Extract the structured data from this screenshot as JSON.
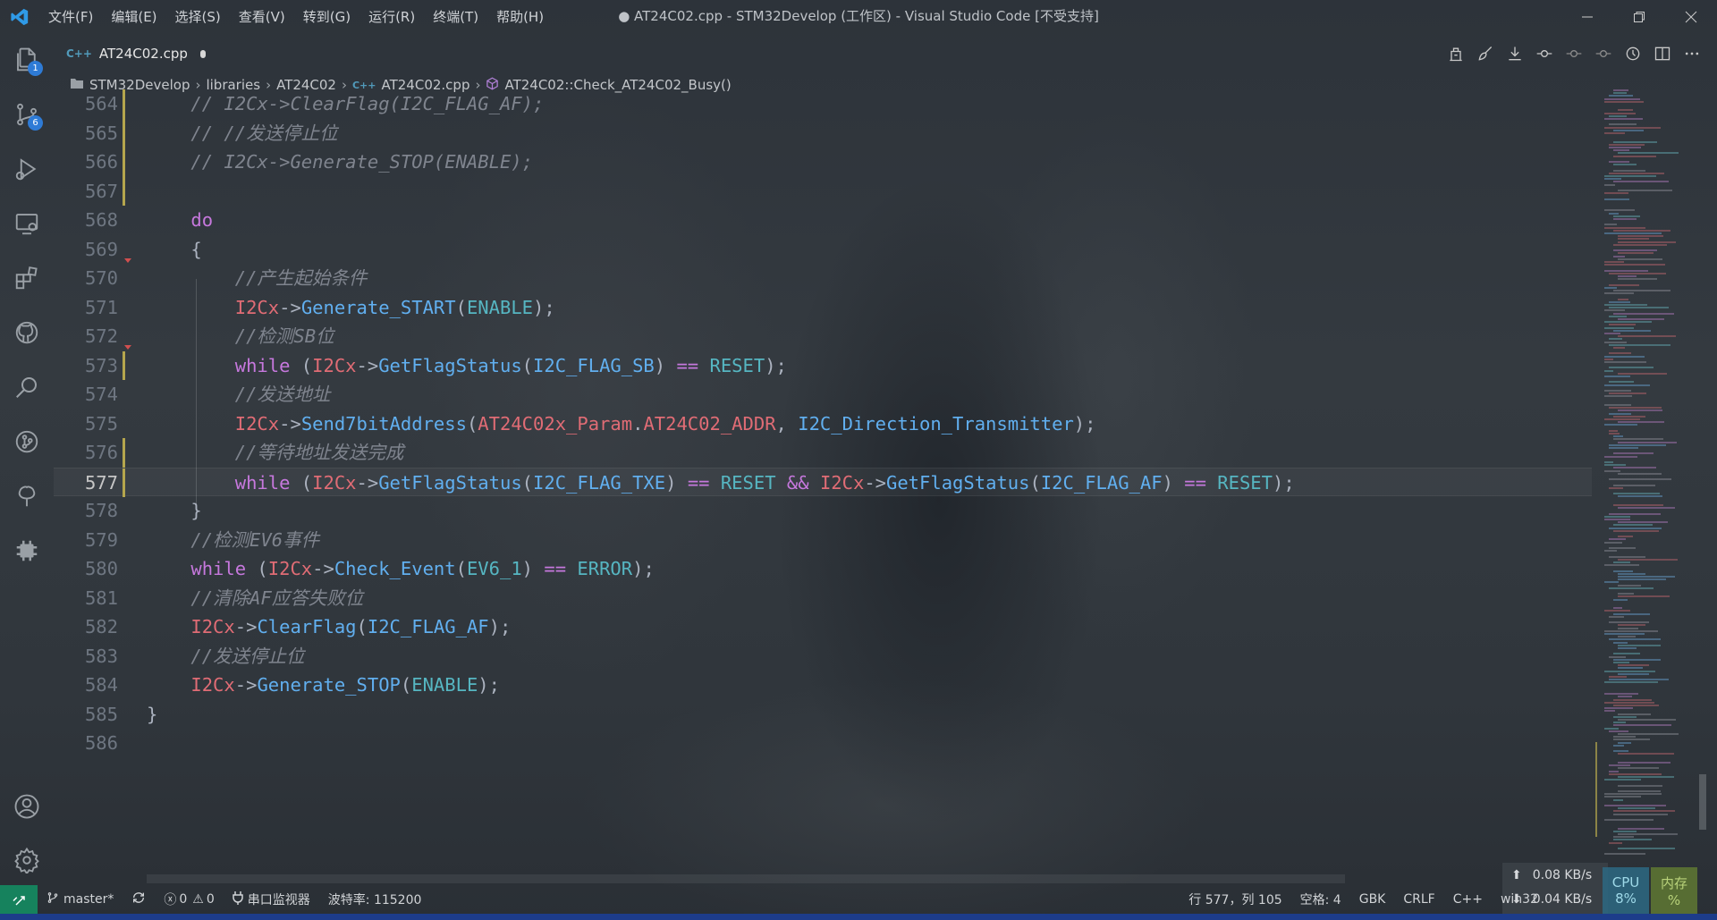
{
  "titlebar": {
    "menu": [
      "文件(F)",
      "编辑(E)",
      "选择(S)",
      "查看(V)",
      "转到(G)",
      "运行(R)",
      "终端(T)",
      "帮助(H)"
    ],
    "window_title": "● AT24C02.cpp - STM32Develop (工作区) - Visual Studio Code [不受支持]"
  },
  "activity_bar": {
    "explorer_badge": "1",
    "scm_badge": "6"
  },
  "tab": {
    "icon_text": "C++",
    "filename": "AT24C02.cpp"
  },
  "breadcrumb": {
    "items": [
      "STM32Develop",
      "libraries",
      "AT24C02",
      "AT24C02.cpp",
      "AT24C02::Check_AT24C02_Busy()"
    ]
  },
  "editor": {
    "lines": [
      {
        "n": "564",
        "tokens": [
          [
            "cm",
            "// I2Cx->ClearFlag(I2C_FLAG_AF);"
          ]
        ]
      },
      {
        "n": "565",
        "tokens": [
          [
            "cm",
            "// //发送停止位"
          ]
        ]
      },
      {
        "n": "566",
        "tokens": [
          [
            "cm",
            "// I2Cx->Generate_STOP(ENABLE);"
          ]
        ]
      },
      {
        "n": "567",
        "tokens": []
      },
      {
        "n": "568",
        "tokens": [
          [
            "kw",
            "do"
          ]
        ]
      },
      {
        "n": "569",
        "tokens": [
          [
            "pun",
            "{"
          ]
        ]
      },
      {
        "n": "570",
        "tokens": [
          [
            "cm",
            "    //产生起始条件"
          ]
        ]
      },
      {
        "n": "571",
        "tokens": [
          [
            "sp",
            "    "
          ],
          [
            "var",
            "I2Cx"
          ],
          [
            "pun",
            "->"
          ],
          [
            "fn",
            "Generate_START"
          ],
          [
            "pun",
            "("
          ],
          [
            "cst",
            "ENABLE"
          ],
          [
            "pun",
            ");"
          ]
        ]
      },
      {
        "n": "572",
        "tokens": [
          [
            "cm",
            "    //检测SB位"
          ]
        ]
      },
      {
        "n": "573",
        "tokens": [
          [
            "sp",
            "    "
          ],
          [
            "kw",
            "while"
          ],
          [
            "pun",
            " ("
          ],
          [
            "var",
            "I2Cx"
          ],
          [
            "pun",
            "->"
          ],
          [
            "fn",
            "GetFlagStatus"
          ],
          [
            "pun",
            "("
          ],
          [
            "fn",
            "I2C_FLAG_SB"
          ],
          [
            "pun",
            ") "
          ],
          [
            "kw",
            "=="
          ],
          [
            "pun",
            " "
          ],
          [
            "cst",
            "RESET"
          ],
          [
            "pun",
            ");"
          ]
        ]
      },
      {
        "n": "574",
        "tokens": [
          [
            "cm",
            "    //发送地址"
          ]
        ]
      },
      {
        "n": "575",
        "tokens": [
          [
            "sp",
            "    "
          ],
          [
            "var",
            "I2Cx"
          ],
          [
            "pun",
            "->"
          ],
          [
            "fn",
            "Send7bitAddress"
          ],
          [
            "pun",
            "("
          ],
          [
            "var",
            "AT24C02x_Param"
          ],
          [
            "pun",
            "."
          ],
          [
            "var",
            "AT24C02_ADDR"
          ],
          [
            "pun",
            ", "
          ],
          [
            "fn",
            "I2C_Direction_Transmitter"
          ],
          [
            "pun",
            ");"
          ]
        ]
      },
      {
        "n": "576",
        "tokens": [
          [
            "cm",
            "    //等待地址发送完成"
          ]
        ]
      },
      {
        "n": "577",
        "tokens": [
          [
            "sp",
            "    "
          ],
          [
            "kw",
            "while"
          ],
          [
            "pun",
            " ("
          ],
          [
            "var",
            "I2Cx"
          ],
          [
            "pun",
            "->"
          ],
          [
            "fn",
            "GetFlagStatus"
          ],
          [
            "pun",
            "("
          ],
          [
            "fn",
            "I2C_FLAG_TXE"
          ],
          [
            "pun",
            ") "
          ],
          [
            "kw",
            "=="
          ],
          [
            "pun",
            " "
          ],
          [
            "cst",
            "RESET"
          ],
          [
            "pun",
            " "
          ],
          [
            "kw",
            "&&"
          ],
          [
            "pun",
            " "
          ],
          [
            "var",
            "I2Cx"
          ],
          [
            "pun",
            "->"
          ],
          [
            "fn",
            "GetFlagStatus"
          ],
          [
            "pun",
            "("
          ],
          [
            "fn",
            "I2C_FLAG_AF"
          ],
          [
            "pun",
            ") "
          ],
          [
            "kw",
            "=="
          ],
          [
            "pun",
            " "
          ],
          [
            "cst",
            "RESET"
          ],
          [
            "pun",
            ");"
          ]
        ]
      },
      {
        "n": "578",
        "tokens": [
          [
            "pun",
            "}"
          ]
        ]
      },
      {
        "n": "579",
        "tokens": [
          [
            "cm",
            "//检测EV6事件"
          ]
        ]
      },
      {
        "n": "580",
        "tokens": [
          [
            "kw",
            "while"
          ],
          [
            "pun",
            " ("
          ],
          [
            "var",
            "I2Cx"
          ],
          [
            "pun",
            "->"
          ],
          [
            "fn",
            "Check_Event"
          ],
          [
            "pun",
            "("
          ],
          [
            "cst",
            "EV6_1"
          ],
          [
            "pun",
            ") "
          ],
          [
            "kw",
            "=="
          ],
          [
            "pun",
            " "
          ],
          [
            "cst",
            "ERROR"
          ],
          [
            "pun",
            ");"
          ]
        ]
      },
      {
        "n": "581",
        "tokens": [
          [
            "cm",
            "//清除AF应答失败位"
          ]
        ]
      },
      {
        "n": "582",
        "tokens": [
          [
            "var",
            "I2Cx"
          ],
          [
            "pun",
            "->"
          ],
          [
            "fn",
            "ClearFlag"
          ],
          [
            "pun",
            "("
          ],
          [
            "fn",
            "I2C_FLAG_AF"
          ],
          [
            "pun",
            ");"
          ]
        ]
      },
      {
        "n": "583",
        "tokens": [
          [
            "cm",
            "//发送停止位"
          ]
        ]
      },
      {
        "n": "584",
        "tokens": [
          [
            "var",
            "I2Cx"
          ],
          [
            "pun",
            "->"
          ],
          [
            "fn",
            "Generate_STOP"
          ],
          [
            "pun",
            "("
          ],
          [
            "cst",
            "ENABLE"
          ],
          [
            "pun",
            ");"
          ]
        ]
      },
      {
        "n": "585",
        "tokens": [
          [
            "pun",
            "}"
          ]
        ]
      },
      {
        "n": "586",
        "tokens": []
      }
    ],
    "current_line": "577"
  },
  "statusbar": {
    "branch": "master*",
    "errors": "0",
    "warnings": "0",
    "serial_monitor": "串口监视器",
    "baud_rate": "波特率: 115200",
    "cursor_position": "行 577，列 105",
    "indent": "空格: 4",
    "encoding": "GBK",
    "eol": "CRLF",
    "language": "C++",
    "platform": "win32"
  },
  "net_widget": {
    "upload": "0.08 KB/s",
    "download": "0.04 KB/s",
    "cpu_label": "CPU",
    "cpu_value": "8%",
    "mem_label": "内存",
    "mem_value": "%"
  },
  "colors": {
    "keyword": "#c678dd",
    "variable": "#e06c75",
    "function": "#61afef",
    "constant": "#56b6c2",
    "comment": "#7f848e",
    "accent_remote": "#16825d",
    "badge": "#2e7bd6"
  }
}
